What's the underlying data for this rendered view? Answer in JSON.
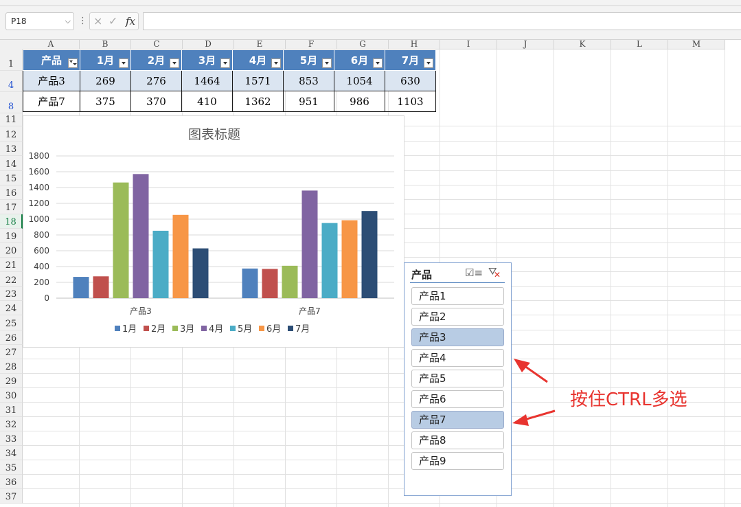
{
  "formula_bar": {
    "name_box": "P18",
    "cancel_icon": "×",
    "enter_icon": "✓",
    "fx_label": "fx",
    "formula_value": ""
  },
  "sheet": {
    "columns": [
      "A",
      "B",
      "C",
      "D",
      "E",
      "F",
      "G",
      "H",
      "I",
      "J",
      "K",
      "L",
      "M"
    ],
    "rows": [
      "1",
      "4",
      "8",
      "11",
      "12",
      "13",
      "14",
      "15",
      "16",
      "17",
      "18",
      "19",
      "20",
      "21",
      "22",
      "23",
      "24",
      "25",
      "26",
      "27",
      "28",
      "29",
      "30",
      "31",
      "32",
      "33",
      "34",
      "35",
      "36",
      "37"
    ],
    "selected_row": "18",
    "filtered_rows": [
      "4",
      "8"
    ]
  },
  "table": {
    "headers": [
      "产品",
      "1月",
      "2月",
      "3月",
      "4月",
      "5月",
      "6月",
      "7月"
    ],
    "rows": [
      [
        "产品3",
        "269",
        "276",
        "1464",
        "1571",
        "853",
        "1054",
        "630"
      ],
      [
        "产品7",
        "375",
        "370",
        "410",
        "1362",
        "951",
        "986",
        "1103"
      ]
    ]
  },
  "chart_data": {
    "type": "bar",
    "title": "图表标题",
    "categories": [
      "产品3",
      "产品7"
    ],
    "series": [
      {
        "name": "1月",
        "color": "#4f81bd",
        "values": [
          269,
          375
        ]
      },
      {
        "name": "2月",
        "color": "#c0504d",
        "values": [
          276,
          370
        ]
      },
      {
        "name": "3月",
        "color": "#9bbb59",
        "values": [
          1464,
          410
        ]
      },
      {
        "name": "4月",
        "color": "#8064a2",
        "values": [
          1571,
          1362
        ]
      },
      {
        "name": "5月",
        "color": "#4bacc6",
        "values": [
          853,
          951
        ]
      },
      {
        "name": "6月",
        "color": "#f79646",
        "values": [
          1054,
          986
        ]
      },
      {
        "name": "7月",
        "color": "#2c4d75",
        "values": [
          630,
          1103
        ]
      }
    ],
    "ylim": [
      0,
      1800
    ],
    "yticks": [
      "0",
      "200",
      "400",
      "600",
      "800",
      "1000",
      "1200",
      "1400",
      "1600",
      "1800"
    ],
    "grid": true,
    "legend": "bottom"
  },
  "slicer": {
    "title": "产品",
    "multiselect_icon": "multi-select-icon",
    "clear_filter_icon": "clear-filter-icon",
    "items": [
      {
        "label": "产品1",
        "selected": false
      },
      {
        "label": "产品2",
        "selected": false
      },
      {
        "label": "产品3",
        "selected": true
      },
      {
        "label": "产品4",
        "selected": false
      },
      {
        "label": "产品5",
        "selected": false
      },
      {
        "label": "产品6",
        "selected": false
      },
      {
        "label": "产品7",
        "selected": true
      },
      {
        "label": "产品8",
        "selected": false
      },
      {
        "label": "产品9",
        "selected": false
      }
    ]
  },
  "annotation": {
    "text": "按住CTRL多选",
    "color": "#e8342f"
  }
}
